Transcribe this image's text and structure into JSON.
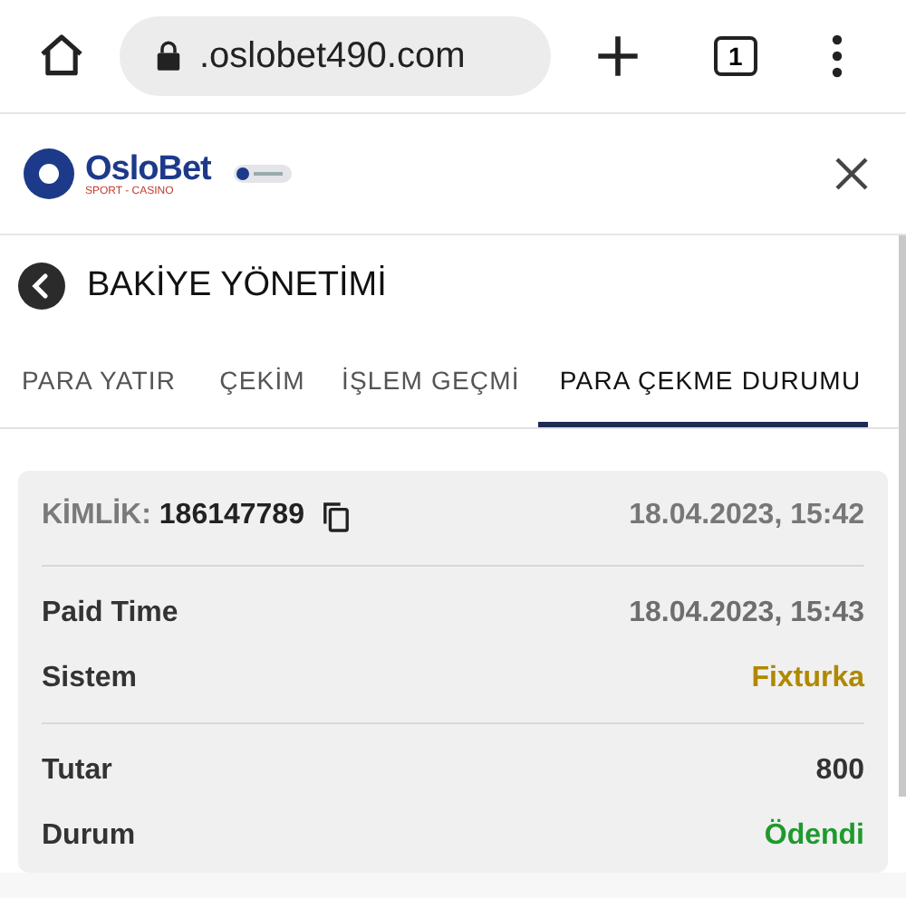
{
  "browser": {
    "url": ".oslobet490.com",
    "tab_count": "1"
  },
  "header": {
    "brand": "OsloBet",
    "tagline": "SPORT - CASINO"
  },
  "page_title": "BAKİYE YÖNETİMİ",
  "tabs": [
    {
      "label": "PARA YATIR",
      "selected": false
    },
    {
      "label": "ÇEKİM",
      "selected": false
    },
    {
      "label": "İŞLEM GEÇMİ",
      "selected": false
    },
    {
      "label": "PARA ÇEKME DURUMU",
      "selected": true
    }
  ],
  "card": {
    "id_label": "KİMLİK:",
    "id_value": "186147789",
    "date": "18.04.2023, 15:42",
    "sections": [
      [
        {
          "label": "Paid Time",
          "value": "18.04.2023, 15:43",
          "color": "#6e6e6e"
        },
        {
          "label": "Sistem",
          "value": "Fixturka",
          "color": "#b08800"
        }
      ],
      [
        {
          "label": "Tutar",
          "value": "800",
          "color": "#333333"
        },
        {
          "label": "Durum",
          "value": "Ödendi",
          "color": "#1e9a2e"
        }
      ]
    ]
  }
}
